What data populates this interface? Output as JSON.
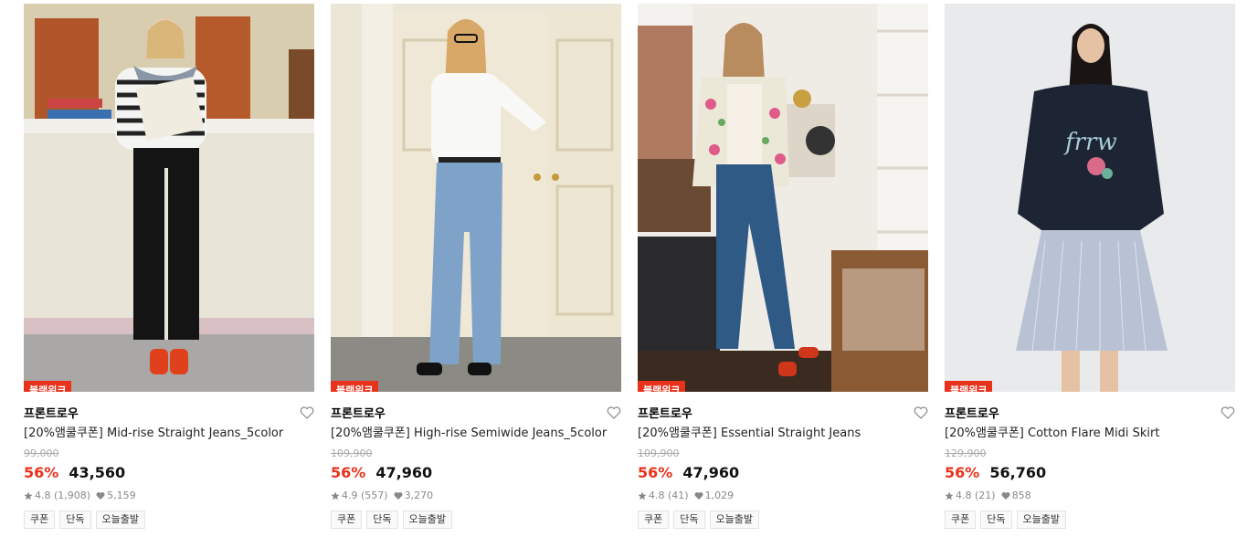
{
  "badge_label": "블랙위크",
  "products": [
    {
      "brand": "프론트로우",
      "title": "[20%앰쿨쿠폰] Mid-rise Straight Jeans_5color",
      "original_price": "99,000",
      "discount": "56%",
      "price": "43,560",
      "rating": "4.8 (1,908)",
      "likes": "5,159",
      "tags": [
        "쿠폰",
        "단독",
        "오늘출발"
      ]
    },
    {
      "brand": "프론트로우",
      "title": "[20%앰쿨쿠폰] High-rise Semiwide Jeans_5color",
      "original_price": "109,900",
      "discount": "56%",
      "price": "47,960",
      "rating": "4.9 (557)",
      "likes": "3,270",
      "tags": [
        "쿠폰",
        "단독",
        "오늘출발"
      ]
    },
    {
      "brand": "프론트로우",
      "title": "[20%앰쿨쿠폰] Essential Straight Jeans",
      "original_price": "109,900",
      "discount": "56%",
      "price": "47,960",
      "rating": "4.8 (41)",
      "likes": "1,029",
      "tags": [
        "쿠폰",
        "단독",
        "오늘출발"
      ]
    },
    {
      "brand": "프론트로우",
      "title": "[20%앰쿨쿠폰] Cotton Flare Midi Skirt",
      "original_price": "129,900",
      "discount": "56%",
      "price": "56,760",
      "rating": "4.8 (21)",
      "likes": "858",
      "tags": [
        "쿠폰",
        "단독",
        "오늘출발"
      ]
    }
  ]
}
